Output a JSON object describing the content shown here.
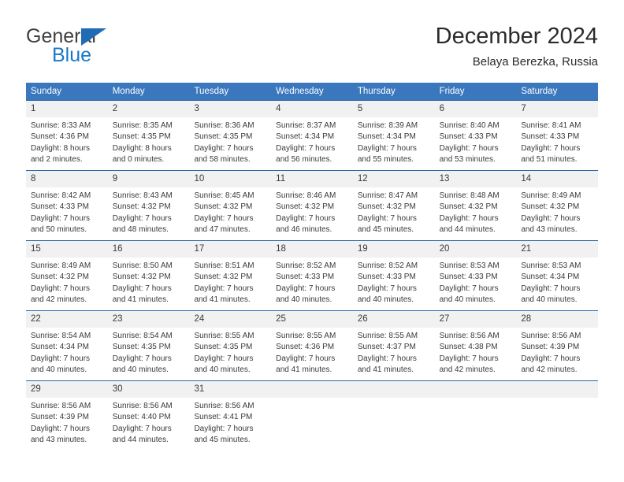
{
  "logo": {
    "word1": "General",
    "word2": "Blue",
    "triangle_color": "#1f6cb4",
    "word2_color": "#1878c8"
  },
  "header": {
    "title": "December 2024",
    "subtitle": "Belaya Berezka, Russia"
  },
  "theme": {
    "header_bg": "#3a77bd",
    "row_divider": "#2b68a8",
    "day_number_bg": "#f1f1f1",
    "text": "#3a3a3a"
  },
  "calendar": {
    "weekday_headers": [
      "Sunday",
      "Monday",
      "Tuesday",
      "Wednesday",
      "Thursday",
      "Friday",
      "Saturday"
    ],
    "weeks": [
      [
        {
          "day": "1",
          "sunrise": "Sunrise: 8:33 AM",
          "sunset": "Sunset: 4:36 PM",
          "daylight1": "Daylight: 8 hours",
          "daylight2": "and 2 minutes."
        },
        {
          "day": "2",
          "sunrise": "Sunrise: 8:35 AM",
          "sunset": "Sunset: 4:35 PM",
          "daylight1": "Daylight: 8 hours",
          "daylight2": "and 0 minutes."
        },
        {
          "day": "3",
          "sunrise": "Sunrise: 8:36 AM",
          "sunset": "Sunset: 4:35 PM",
          "daylight1": "Daylight: 7 hours",
          "daylight2": "and 58 minutes."
        },
        {
          "day": "4",
          "sunrise": "Sunrise: 8:37 AM",
          "sunset": "Sunset: 4:34 PM",
          "daylight1": "Daylight: 7 hours",
          "daylight2": "and 56 minutes."
        },
        {
          "day": "5",
          "sunrise": "Sunrise: 8:39 AM",
          "sunset": "Sunset: 4:34 PM",
          "daylight1": "Daylight: 7 hours",
          "daylight2": "and 55 minutes."
        },
        {
          "day": "6",
          "sunrise": "Sunrise: 8:40 AM",
          "sunset": "Sunset: 4:33 PM",
          "daylight1": "Daylight: 7 hours",
          "daylight2": "and 53 minutes."
        },
        {
          "day": "7",
          "sunrise": "Sunrise: 8:41 AM",
          "sunset": "Sunset: 4:33 PM",
          "daylight1": "Daylight: 7 hours",
          "daylight2": "and 51 minutes."
        }
      ],
      [
        {
          "day": "8",
          "sunrise": "Sunrise: 8:42 AM",
          "sunset": "Sunset: 4:33 PM",
          "daylight1": "Daylight: 7 hours",
          "daylight2": "and 50 minutes."
        },
        {
          "day": "9",
          "sunrise": "Sunrise: 8:43 AM",
          "sunset": "Sunset: 4:32 PM",
          "daylight1": "Daylight: 7 hours",
          "daylight2": "and 48 minutes."
        },
        {
          "day": "10",
          "sunrise": "Sunrise: 8:45 AM",
          "sunset": "Sunset: 4:32 PM",
          "daylight1": "Daylight: 7 hours",
          "daylight2": "and 47 minutes."
        },
        {
          "day": "11",
          "sunrise": "Sunrise: 8:46 AM",
          "sunset": "Sunset: 4:32 PM",
          "daylight1": "Daylight: 7 hours",
          "daylight2": "and 46 minutes."
        },
        {
          "day": "12",
          "sunrise": "Sunrise: 8:47 AM",
          "sunset": "Sunset: 4:32 PM",
          "daylight1": "Daylight: 7 hours",
          "daylight2": "and 45 minutes."
        },
        {
          "day": "13",
          "sunrise": "Sunrise: 8:48 AM",
          "sunset": "Sunset: 4:32 PM",
          "daylight1": "Daylight: 7 hours",
          "daylight2": "and 44 minutes."
        },
        {
          "day": "14",
          "sunrise": "Sunrise: 8:49 AM",
          "sunset": "Sunset: 4:32 PM",
          "daylight1": "Daylight: 7 hours",
          "daylight2": "and 43 minutes."
        }
      ],
      [
        {
          "day": "15",
          "sunrise": "Sunrise: 8:49 AM",
          "sunset": "Sunset: 4:32 PM",
          "daylight1": "Daylight: 7 hours",
          "daylight2": "and 42 minutes."
        },
        {
          "day": "16",
          "sunrise": "Sunrise: 8:50 AM",
          "sunset": "Sunset: 4:32 PM",
          "daylight1": "Daylight: 7 hours",
          "daylight2": "and 41 minutes."
        },
        {
          "day": "17",
          "sunrise": "Sunrise: 8:51 AM",
          "sunset": "Sunset: 4:32 PM",
          "daylight1": "Daylight: 7 hours",
          "daylight2": "and 41 minutes."
        },
        {
          "day": "18",
          "sunrise": "Sunrise: 8:52 AM",
          "sunset": "Sunset: 4:33 PM",
          "daylight1": "Daylight: 7 hours",
          "daylight2": "and 40 minutes."
        },
        {
          "day": "19",
          "sunrise": "Sunrise: 8:52 AM",
          "sunset": "Sunset: 4:33 PM",
          "daylight1": "Daylight: 7 hours",
          "daylight2": "and 40 minutes."
        },
        {
          "day": "20",
          "sunrise": "Sunrise: 8:53 AM",
          "sunset": "Sunset: 4:33 PM",
          "daylight1": "Daylight: 7 hours",
          "daylight2": "and 40 minutes."
        },
        {
          "day": "21",
          "sunrise": "Sunrise: 8:53 AM",
          "sunset": "Sunset: 4:34 PM",
          "daylight1": "Daylight: 7 hours",
          "daylight2": "and 40 minutes."
        }
      ],
      [
        {
          "day": "22",
          "sunrise": "Sunrise: 8:54 AM",
          "sunset": "Sunset: 4:34 PM",
          "daylight1": "Daylight: 7 hours",
          "daylight2": "and 40 minutes."
        },
        {
          "day": "23",
          "sunrise": "Sunrise: 8:54 AM",
          "sunset": "Sunset: 4:35 PM",
          "daylight1": "Daylight: 7 hours",
          "daylight2": "and 40 minutes."
        },
        {
          "day": "24",
          "sunrise": "Sunrise: 8:55 AM",
          "sunset": "Sunset: 4:35 PM",
          "daylight1": "Daylight: 7 hours",
          "daylight2": "and 40 minutes."
        },
        {
          "day": "25",
          "sunrise": "Sunrise: 8:55 AM",
          "sunset": "Sunset: 4:36 PM",
          "daylight1": "Daylight: 7 hours",
          "daylight2": "and 41 minutes."
        },
        {
          "day": "26",
          "sunrise": "Sunrise: 8:55 AM",
          "sunset": "Sunset: 4:37 PM",
          "daylight1": "Daylight: 7 hours",
          "daylight2": "and 41 minutes."
        },
        {
          "day": "27",
          "sunrise": "Sunrise: 8:56 AM",
          "sunset": "Sunset: 4:38 PM",
          "daylight1": "Daylight: 7 hours",
          "daylight2": "and 42 minutes."
        },
        {
          "day": "28",
          "sunrise": "Sunrise: 8:56 AM",
          "sunset": "Sunset: 4:39 PM",
          "daylight1": "Daylight: 7 hours",
          "daylight2": "and 42 minutes."
        }
      ],
      [
        {
          "day": "29",
          "sunrise": "Sunrise: 8:56 AM",
          "sunset": "Sunset: 4:39 PM",
          "daylight1": "Daylight: 7 hours",
          "daylight2": "and 43 minutes."
        },
        {
          "day": "30",
          "sunrise": "Sunrise: 8:56 AM",
          "sunset": "Sunset: 4:40 PM",
          "daylight1": "Daylight: 7 hours",
          "daylight2": "and 44 minutes."
        },
        {
          "day": "31",
          "sunrise": "Sunrise: 8:56 AM",
          "sunset": "Sunset: 4:41 PM",
          "daylight1": "Daylight: 7 hours",
          "daylight2": "and 45 minutes."
        },
        {
          "day": "",
          "sunrise": "",
          "sunset": "",
          "daylight1": "",
          "daylight2": ""
        },
        {
          "day": "",
          "sunrise": "",
          "sunset": "",
          "daylight1": "",
          "daylight2": ""
        },
        {
          "day": "",
          "sunrise": "",
          "sunset": "",
          "daylight1": "",
          "daylight2": ""
        },
        {
          "day": "",
          "sunrise": "",
          "sunset": "",
          "daylight1": "",
          "daylight2": ""
        }
      ]
    ]
  }
}
